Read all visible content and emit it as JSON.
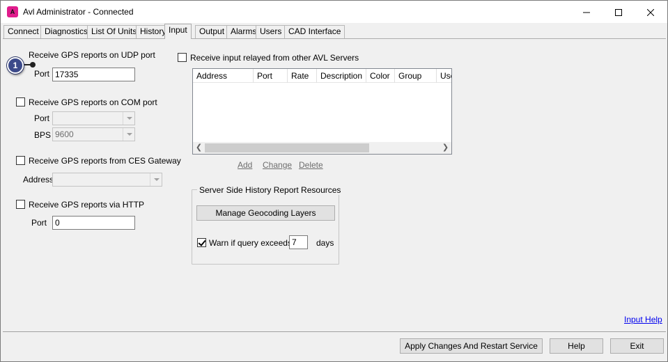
{
  "window": {
    "title": "Avl Administrator - Connected",
    "app_icon_text": "A"
  },
  "tabs": [
    {
      "label": "Connect"
    },
    {
      "label": "Diagnostics"
    },
    {
      "label": "List Of Units"
    },
    {
      "label": "History"
    },
    {
      "label": "Input"
    },
    {
      "label": "Output"
    },
    {
      "label": "Alarms"
    },
    {
      "label": "Users"
    },
    {
      "label": "CAD Interface"
    }
  ],
  "active_tab": "Input",
  "callout": {
    "number": "1"
  },
  "udp": {
    "label": "Receive GPS reports on UDP port",
    "port_label": "Port",
    "port_value": "17335"
  },
  "com": {
    "label": "Receive GPS reports on COM port",
    "port_label": "Port",
    "port_value": "",
    "bps_label": "BPS",
    "bps_value": "9600"
  },
  "ces": {
    "label": "Receive GPS reports from CES Gateway",
    "address_label": "Address",
    "address_value": ""
  },
  "http": {
    "label": "Receive GPS reports via HTTP",
    "port_label": "Port",
    "port_value": "0"
  },
  "relay": {
    "label": "Receive input relayed from other AVL Servers",
    "columns": [
      "Address",
      "Port",
      "Rate",
      "Description",
      "Color",
      "Group",
      "Use"
    ],
    "actions": {
      "add": "Add",
      "change": "Change",
      "delete": "Delete"
    }
  },
  "history_group": {
    "title": "Server Side History Report Resources",
    "manage_button": "Manage Geocoding Layers",
    "warn_label": "Warn if query exceeds",
    "warn_value": "7",
    "warn_unit": "days",
    "warn_checked": true
  },
  "help_link": "Input Help",
  "footer": {
    "apply_button": "Apply Changes And Restart Service",
    "help_button": "Help",
    "exit_button": "Exit"
  }
}
